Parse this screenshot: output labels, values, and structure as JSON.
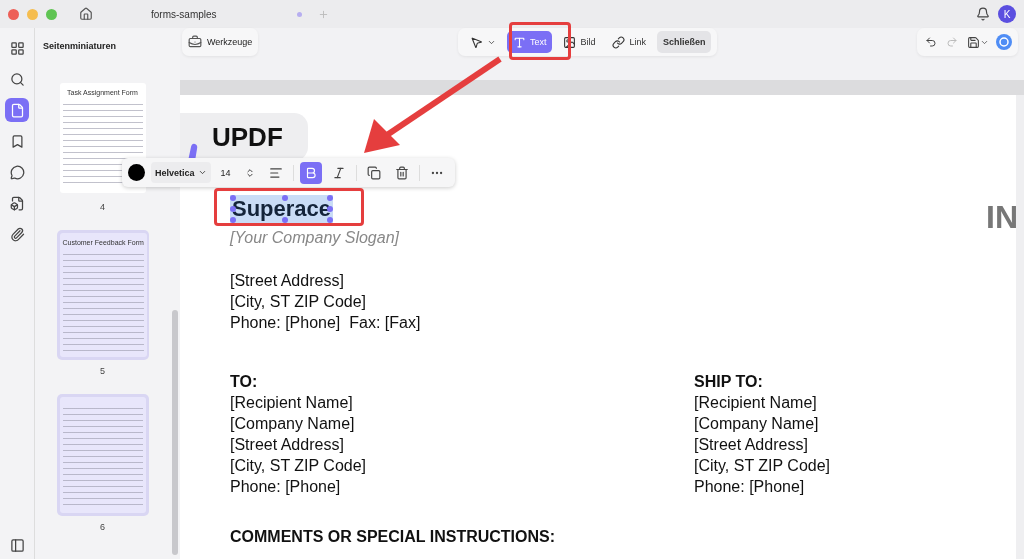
{
  "window": {
    "tab_title": "forms-samples",
    "user_initial": "K"
  },
  "rail": {
    "items": [
      {
        "kind": "grid",
        "selected": false
      },
      {
        "kind": "search",
        "selected": false
      },
      {
        "kind": "pages",
        "selected": true
      },
      {
        "kind": "bookmark",
        "selected": false
      },
      {
        "kind": "comment",
        "selected": false
      },
      {
        "kind": "form",
        "selected": false
      },
      {
        "kind": "attachment",
        "selected": false
      }
    ]
  },
  "sidebar": {
    "title": "Seitenminiaturen",
    "pages": [
      {
        "number": "4",
        "title": "Task Assignment Form",
        "selected": false
      },
      {
        "number": "5",
        "title": "Customer Feedback Form",
        "selected": true
      },
      {
        "number": "6",
        "selected": true
      }
    ]
  },
  "toolbar": {
    "tools_label": "Werkzeuge",
    "modes": [
      {
        "kind": "select",
        "selected": false
      },
      {
        "kind": "text",
        "label": "Text",
        "selected": true
      },
      {
        "kind": "image",
        "label": "Bild",
        "selected": false
      },
      {
        "kind": "link",
        "label": "Link",
        "selected": false
      }
    ],
    "close_label": "Schließen"
  },
  "text_toolbar": {
    "color": "#000000",
    "font": "Helvetica",
    "size": "14",
    "bold": true,
    "italic": false
  },
  "document": {
    "logo": "UPDF",
    "company": "Superace",
    "slogan": "[Your Company Slogan]",
    "heading": "IN",
    "address": [
      "[Street Address]",
      "[City, ST ZIP Code]",
      "Phone: [Phone]  Fax: [Fax]"
    ],
    "blocks": [
      {
        "heading": "TO:",
        "lines": [
          "[Recipient Name]",
          "[Company Name]",
          "[Street Address]",
          "[City, ST ZIP Code]",
          "Phone: [Phone]"
        ]
      },
      {
        "heading": "SHIP TO:",
        "lines": [
          "[Recipient Name]",
          "[Company Name]",
          "[Street Address]",
          "[City, ST ZIP Code]",
          "Phone: [Phone]"
        ]
      }
    ],
    "comments_heading": "COMMENTS OR SPECIAL INSTRUCTIONS:"
  }
}
